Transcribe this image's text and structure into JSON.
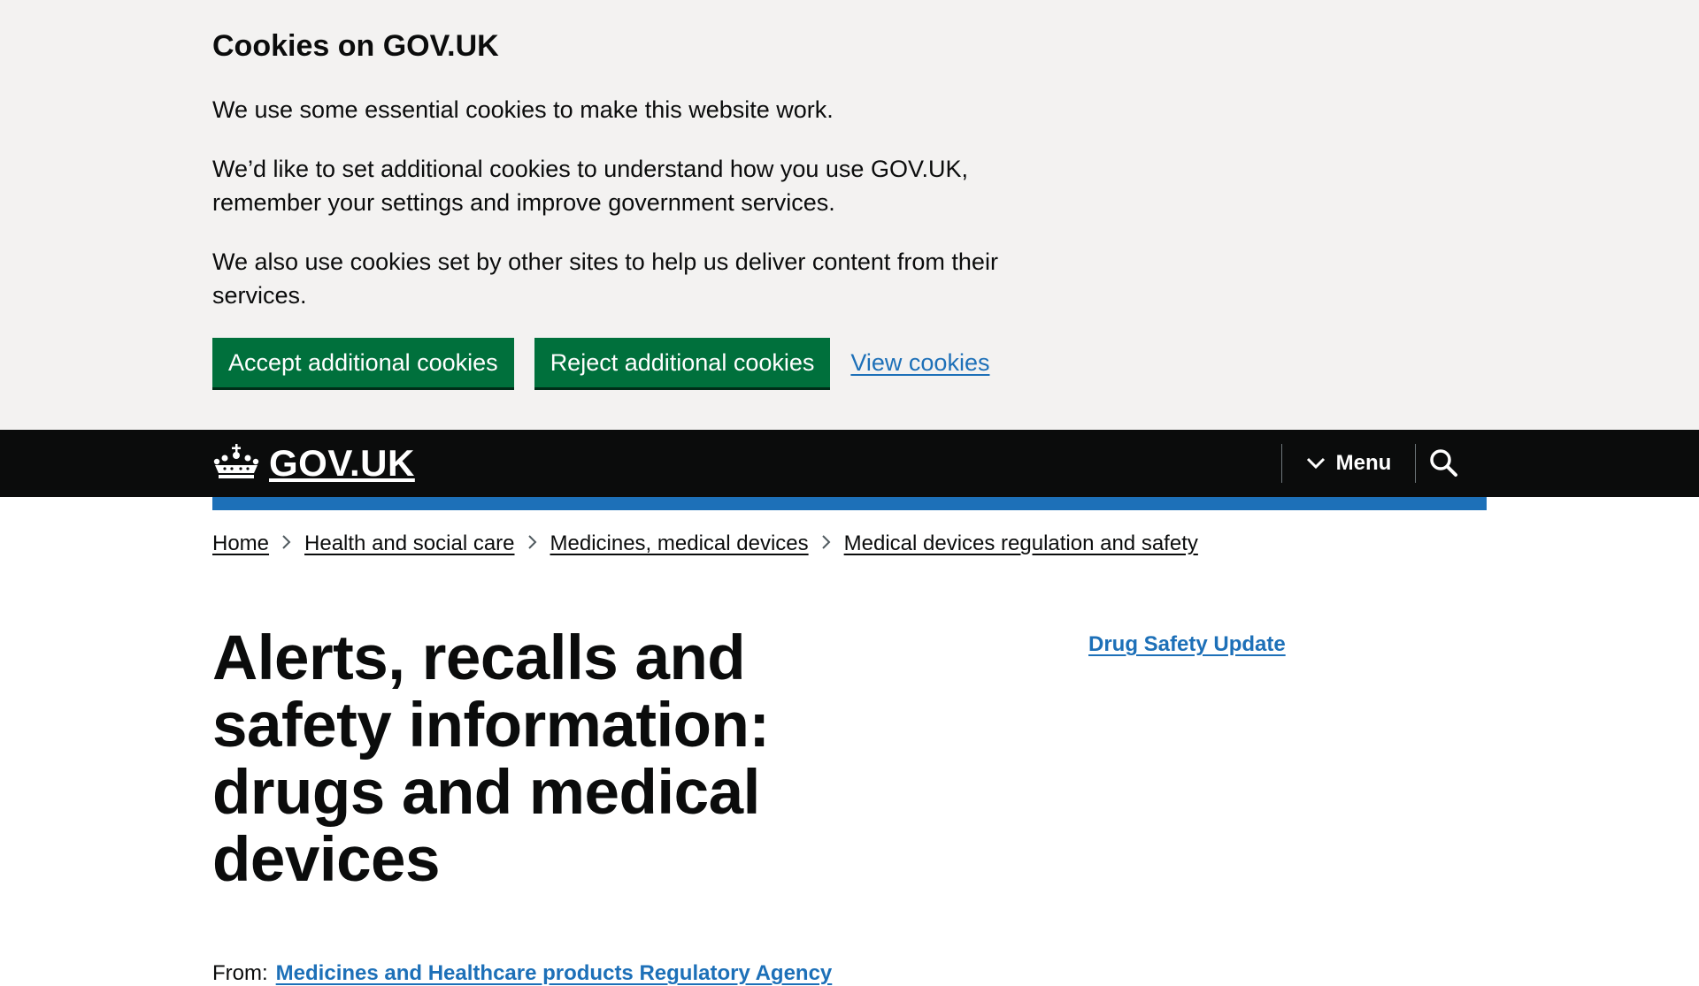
{
  "cookie_banner": {
    "title": "Cookies on GOV.UK",
    "paragraphs": [
      "We use some essential cookies to make this website work.",
      "We’d like to set additional cookies to understand how you use GOV.UK, remember your settings and improve government services.",
      "We also use cookies set by other sites to help us deliver content from their services."
    ],
    "accept_label": "Accept additional cookies",
    "reject_label": "Reject additional cookies",
    "view_label": "View cookies"
  },
  "header": {
    "logo_text": "GOV.UK",
    "menu_label": "Menu",
    "icons": {
      "logo": "crown-icon",
      "menu": "chevron-down-icon",
      "search": "search-icon"
    }
  },
  "breadcrumb": [
    "Home",
    "Health and social care",
    "Medicines, medical devices",
    "Medical devices regulation and safety"
  ],
  "main": {
    "title": "Alerts, recalls and safety information: drugs and medical devices",
    "related_link": "Drug Safety Update",
    "from_label": "From:",
    "from_link": "Medicines and Healthcare products Regulatory Agency"
  },
  "colors": {
    "banner_bg": "#f3f2f1",
    "button_green": "#00703c",
    "link_blue": "#1d70b8",
    "header_black": "#0b0c0c"
  }
}
